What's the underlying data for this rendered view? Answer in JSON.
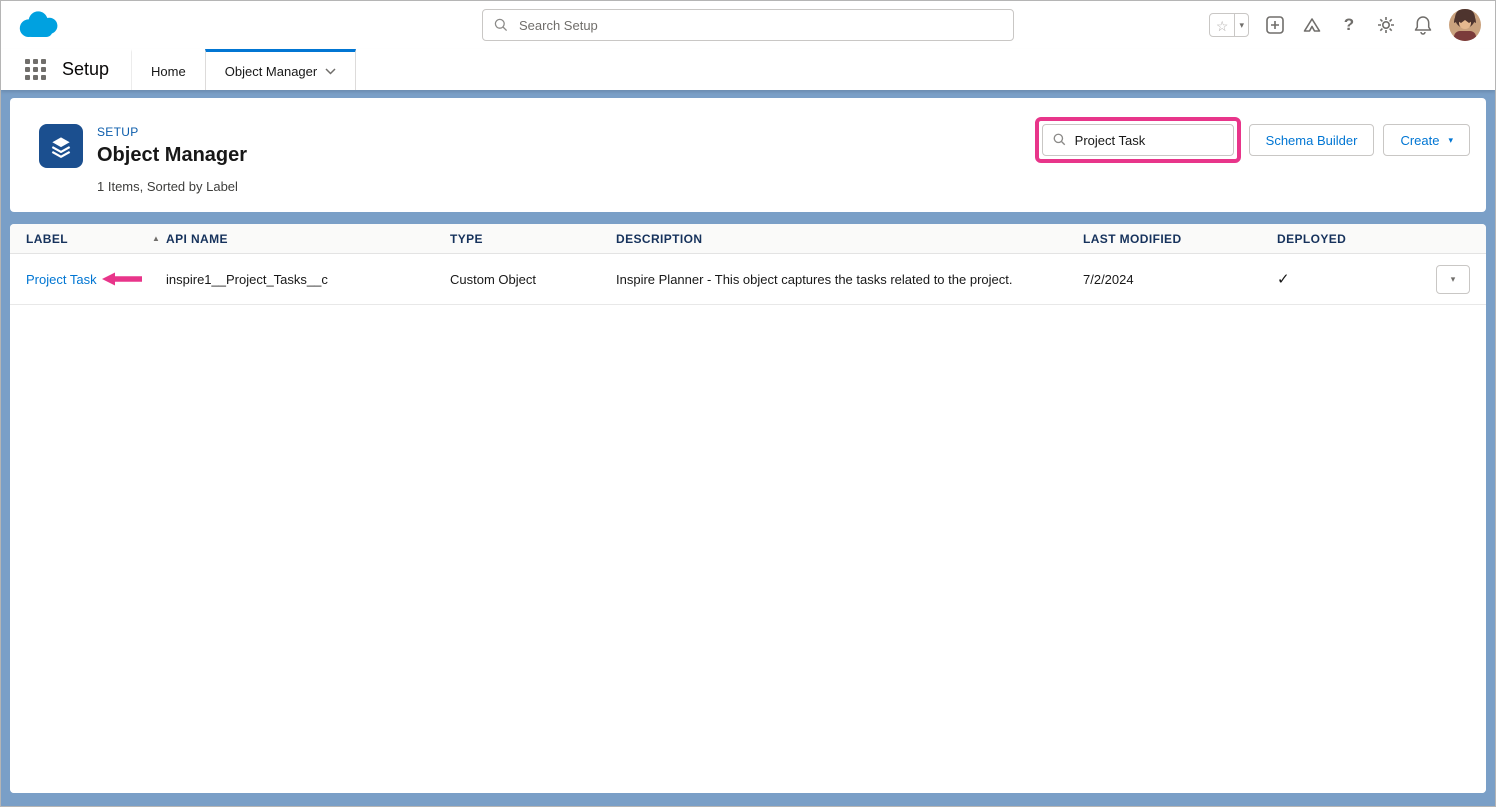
{
  "icons": {
    "star": "☆",
    "caret_down": "▾",
    "sort_asc": "▲",
    "help": "?"
  },
  "global_header": {
    "search_placeholder": "Search Setup"
  },
  "nav": {
    "app_label": "Setup",
    "tabs": [
      {
        "label": "Home"
      },
      {
        "label": "Object Manager"
      }
    ]
  },
  "page_header": {
    "eyebrow": "SETUP",
    "title": "Object Manager",
    "item_count": "1 Items, Sorted by Label",
    "quick_find_value": "Project Task",
    "buttons": {
      "schema_builder": "Schema Builder",
      "create": "Create"
    }
  },
  "table": {
    "columns": [
      "LABEL",
      "API NAME",
      "TYPE",
      "DESCRIPTION",
      "LAST MODIFIED",
      "DEPLOYED"
    ],
    "rows": [
      {
        "label": "Project Task",
        "api_name": "inspire1__Project_Tasks__c",
        "type": "Custom Object",
        "description": "Inspire Planner - This object captures the tasks related to the project.",
        "last_modified": "7/2/2024",
        "deployed": "✓"
      }
    ]
  },
  "colors": {
    "brand_blue": "#0176d3",
    "setup_background_blue": "#7a9fc7",
    "annotation_pink": "#e8358a"
  }
}
